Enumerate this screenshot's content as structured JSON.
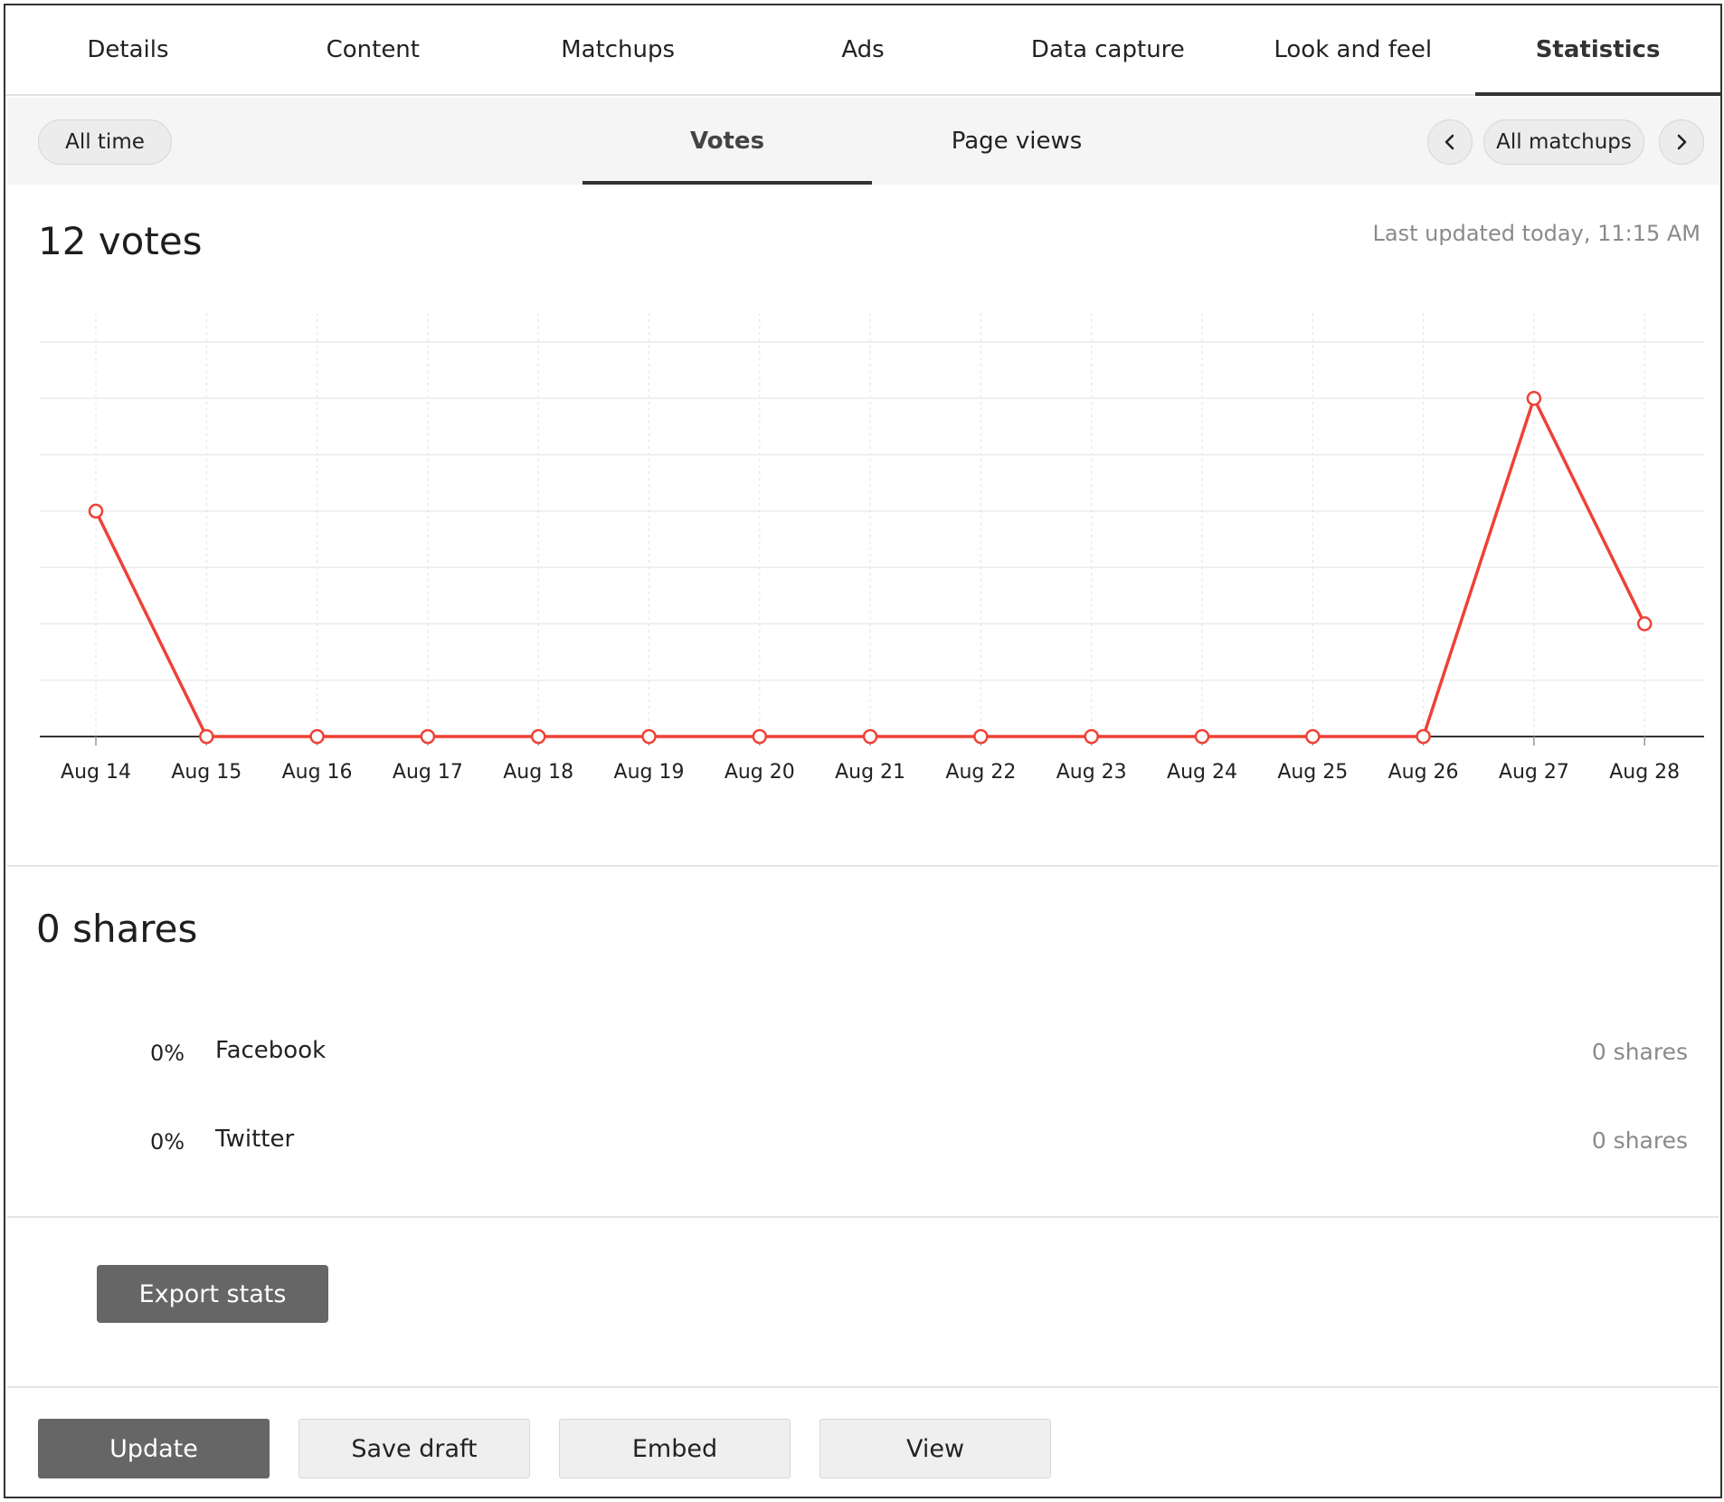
{
  "tabs": [
    {
      "label": "Details"
    },
    {
      "label": "Content"
    },
    {
      "label": "Matchups"
    },
    {
      "label": "Ads"
    },
    {
      "label": "Data capture"
    },
    {
      "label": "Look and feel"
    },
    {
      "label": "Statistics",
      "active": true
    }
  ],
  "toolbar": {
    "time_filter": "All time",
    "subtabs": {
      "votes": "Votes",
      "page_views": "Page views"
    },
    "active_subtab": "Votes",
    "matchup_filter": "All matchups",
    "prev_icon": "chevron-left-icon",
    "next_icon": "chevron-right-icon"
  },
  "votes": {
    "title": "12 votes",
    "last_updated": "Last updated today, 11:15 AM"
  },
  "chart_data": {
    "type": "line",
    "categories": [
      "Aug 14",
      "Aug 15",
      "Aug 16",
      "Aug 17",
      "Aug 18",
      "Aug 19",
      "Aug 20",
      "Aug 21",
      "Aug 22",
      "Aug 23",
      "Aug 24",
      "Aug 25",
      "Aug 26",
      "Aug 27",
      "Aug 28"
    ],
    "series": [
      {
        "values": [
          4,
          0,
          0,
          0,
          0,
          0,
          0,
          0,
          0,
          0,
          0,
          0,
          0,
          6,
          2
        ]
      }
    ],
    "ylim": [
      0,
      7
    ],
    "grid": true,
    "color": "#ef4136"
  },
  "shares": {
    "title": "0 shares",
    "items": [
      {
        "pct": "0%",
        "name": "Facebook",
        "count": "0 shares"
      },
      {
        "pct": "0%",
        "name": "Twitter",
        "count": "0 shares"
      }
    ]
  },
  "export_label": "Export stats",
  "footer": {
    "update": "Update",
    "save_draft": "Save draft",
    "embed": "Embed",
    "view": "View"
  }
}
